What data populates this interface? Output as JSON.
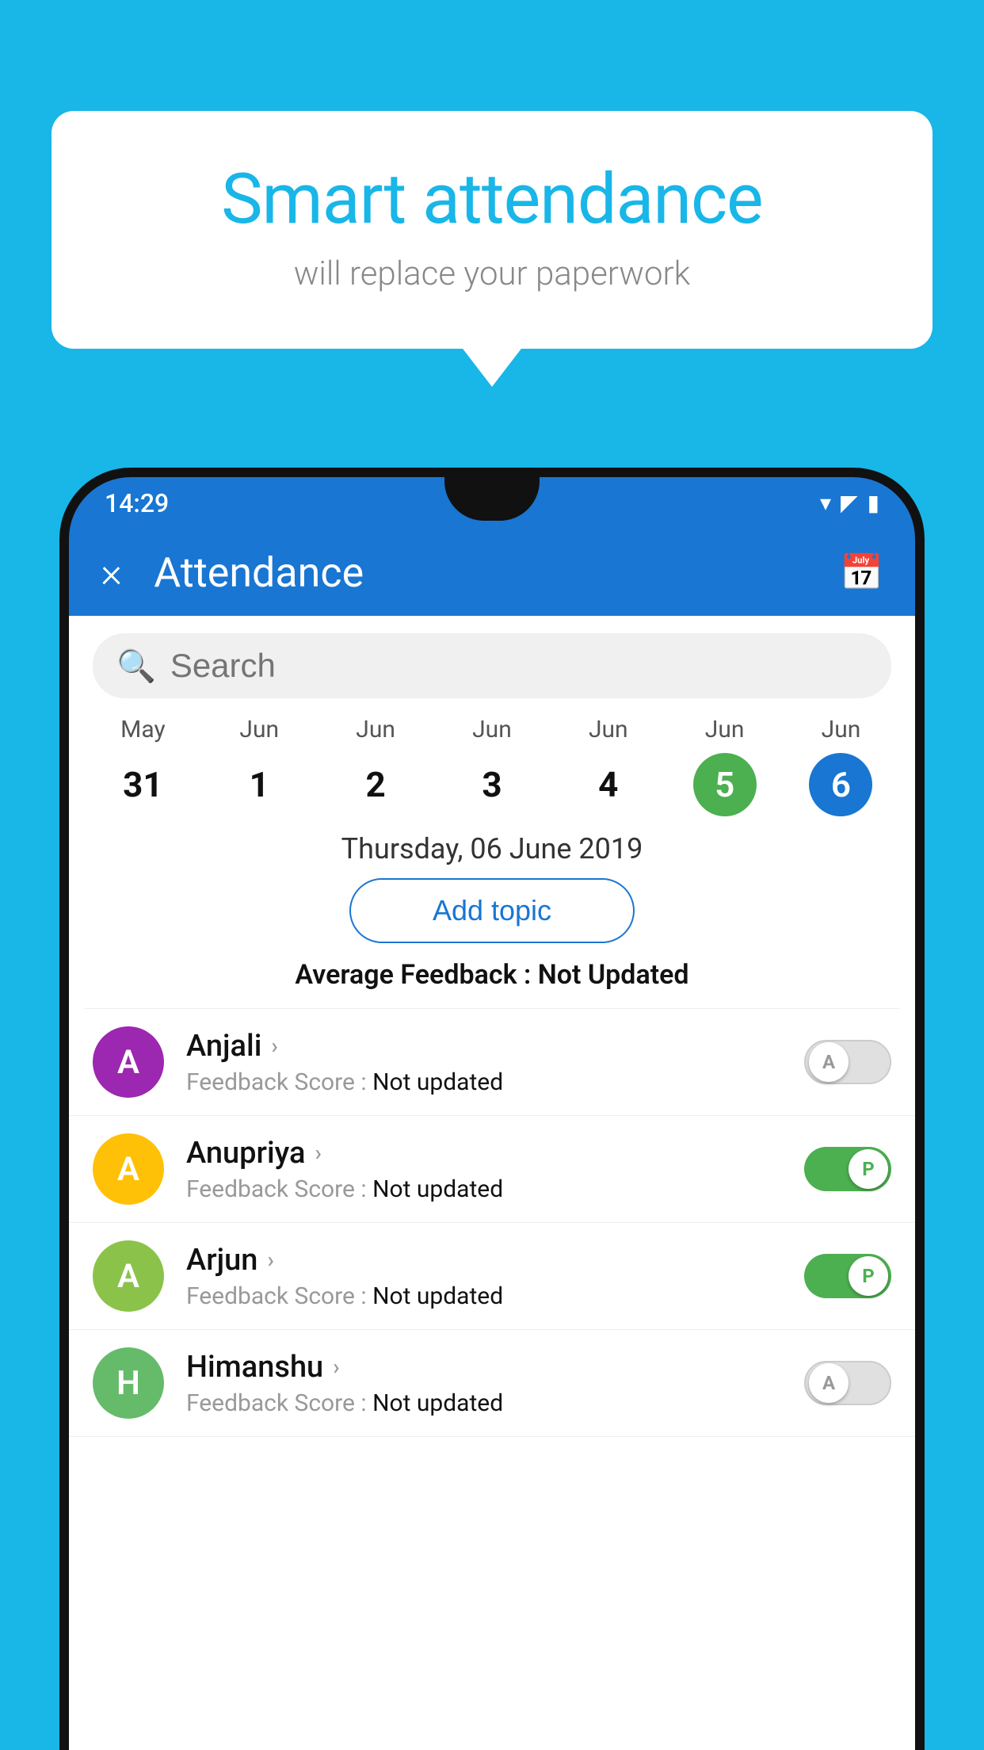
{
  "background_color": "#19b6e8",
  "speech_bubble": {
    "title": "Smart attendance",
    "subtitle": "will replace your paperwork"
  },
  "status_bar": {
    "time": "14:29",
    "wifi_icon": "▼",
    "signal_icon": "▲",
    "battery_icon": "▮"
  },
  "app_bar": {
    "title": "Attendance",
    "close_label": "×",
    "calendar_icon": "📅"
  },
  "search": {
    "placeholder": "Search"
  },
  "calendar": {
    "days": [
      {
        "month": "May",
        "day": "31",
        "state": "normal"
      },
      {
        "month": "Jun",
        "day": "1",
        "state": "normal"
      },
      {
        "month": "Jun",
        "day": "2",
        "state": "normal"
      },
      {
        "month": "Jun",
        "day": "3",
        "state": "normal"
      },
      {
        "month": "Jun",
        "day": "4",
        "state": "normal"
      },
      {
        "month": "Jun",
        "day": "5",
        "state": "today"
      },
      {
        "month": "Jun",
        "day": "6",
        "state": "selected"
      }
    ]
  },
  "date_display": "Thursday, 06 June 2019",
  "add_topic_label": "Add topic",
  "avg_feedback_label": "Average Feedback :",
  "avg_feedback_value": "Not Updated",
  "students": [
    {
      "name": "Anjali",
      "initial": "A",
      "avatar_color": "purple",
      "feedback_label": "Feedback Score :",
      "feedback_value": "Not updated",
      "toggle_state": "off",
      "toggle_letter": "A"
    },
    {
      "name": "Anupriya",
      "initial": "A",
      "avatar_color": "yellow",
      "feedback_label": "Feedback Score :",
      "feedback_value": "Not updated",
      "toggle_state": "on",
      "toggle_letter": "P"
    },
    {
      "name": "Arjun",
      "initial": "A",
      "avatar_color": "green-light",
      "feedback_label": "Feedback Score :",
      "feedback_value": "Not updated",
      "toggle_state": "on",
      "toggle_letter": "P"
    },
    {
      "name": "Himanshu",
      "initial": "H",
      "avatar_color": "green-medium",
      "feedback_label": "Feedback Score :",
      "feedback_value": "Not updated",
      "toggle_state": "off",
      "toggle_letter": "A"
    }
  ]
}
